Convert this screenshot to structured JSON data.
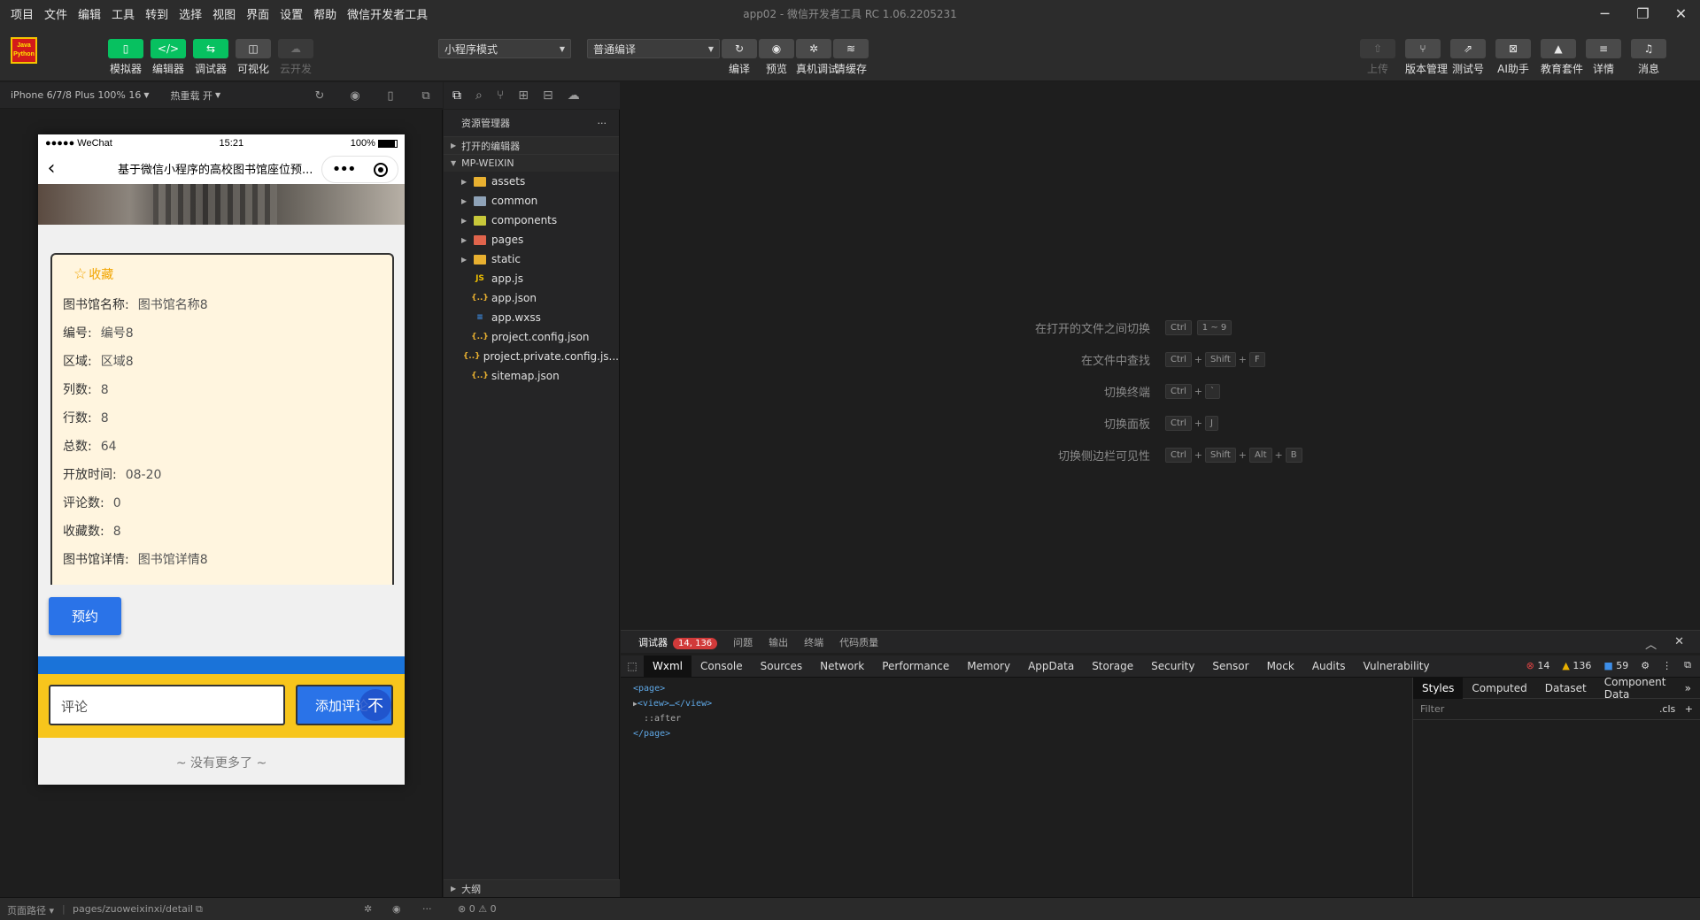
{
  "menu": [
    "项目",
    "文件",
    "编辑",
    "工具",
    "转到",
    "选择",
    "视图",
    "界面",
    "设置",
    "帮助",
    "微信开发者工具"
  ],
  "window_title": "app02 - 微信开发者工具 RC 1.06.2205231",
  "logo": {
    "line1": "Java",
    "line2": "Python"
  },
  "toolbar": {
    "left_buttons": [
      {
        "label": "模拟器",
        "icon": "phone-icon",
        "glyph": "▯"
      },
      {
        "label": "编辑器",
        "icon": "code-icon",
        "glyph": "</>"
      },
      {
        "label": "调试器",
        "icon": "debug-icon",
        "glyph": "⇆"
      },
      {
        "label": "可视化",
        "icon": "layout-icon",
        "glyph": "◫"
      },
      {
        "label": "云开发",
        "icon": "cloud-icon",
        "glyph": "☁"
      }
    ],
    "mode_select": "小程序模式",
    "compile_select": "普通编译",
    "mid_buttons": [
      {
        "label": "编译",
        "icon": "refresh-icon",
        "glyph": "↻"
      },
      {
        "label": "预览",
        "icon": "eye-icon",
        "glyph": "◉"
      },
      {
        "label": "真机调试",
        "icon": "bug-icon",
        "glyph": "✲"
      },
      {
        "label": "清缓存",
        "icon": "layers-icon",
        "glyph": "≋"
      }
    ],
    "right_buttons": [
      {
        "label": "上传",
        "icon": "upload-icon",
        "glyph": "⇧"
      },
      {
        "label": "版本管理",
        "icon": "branch-icon",
        "glyph": "⑂"
      },
      {
        "label": "测试号",
        "icon": "external-icon",
        "glyph": "⇗"
      },
      {
        "label": "AI助手",
        "icon": "ai-icon",
        "glyph": "⊠"
      },
      {
        "label": "教育套件",
        "icon": "graduation-icon",
        "glyph": "▲"
      },
      {
        "label": "详情",
        "icon": "menu-icon",
        "glyph": "≡"
      },
      {
        "label": "消息",
        "icon": "bell-icon",
        "glyph": "♫"
      }
    ]
  },
  "sim": {
    "device": "iPhone 6/7/8 Plus 100% 16",
    "hotreload": "热重载 开"
  },
  "phone": {
    "status_left": "●●●●● WeChat",
    "status_time": "15:21",
    "status_right": "100%",
    "nav_title": "基于微信小程序的高校图书馆座位预...",
    "favorite": "收藏",
    "fields": [
      {
        "k": "图书馆名称:",
        "v": "图书馆名称8"
      },
      {
        "k": "编号:",
        "v": "编号8"
      },
      {
        "k": "区域:",
        "v": "区域8"
      },
      {
        "k": "列数:",
        "v": "8"
      },
      {
        "k": "行数:",
        "v": "8"
      },
      {
        "k": "总数:",
        "v": "64"
      },
      {
        "k": "开放时间:",
        "v": "08-20"
      },
      {
        "k": "评论数:",
        "v": "0"
      },
      {
        "k": "收藏数:",
        "v": "8"
      },
      {
        "k": "图书馆详情:",
        "v": "图书馆详情8"
      }
    ],
    "reserve_button": "预约",
    "comment_placeholder": "评论",
    "add_comment_button": "添加评论",
    "top_fab": "不",
    "no_more": "~ 没有更多了 ~"
  },
  "explorer": {
    "header": "资源管理器",
    "open_editors": "打开的编辑器",
    "project": "MP-WEIXIN",
    "items": [
      {
        "name": "assets",
        "type": "folder",
        "color": "#e8b030",
        "glyph": ""
      },
      {
        "name": "common",
        "type": "folder",
        "color": "#8fa3b8",
        "glyph": ""
      },
      {
        "name": "components",
        "type": "folder",
        "color": "#c8c83a",
        "glyph": ""
      },
      {
        "name": "pages",
        "type": "folder",
        "color": "#e0644c",
        "glyph": ""
      },
      {
        "name": "static",
        "type": "folder",
        "color": "#e8b030",
        "glyph": ""
      },
      {
        "name": "app.js",
        "type": "file",
        "color": "#f0c000",
        "glyph": "JS"
      },
      {
        "name": "app.json",
        "type": "file",
        "color": "#e8b030",
        "glyph": "{..}"
      },
      {
        "name": "app.wxss",
        "type": "file",
        "color": "#3d8ee8",
        "glyph": "≡"
      },
      {
        "name": "project.config.json",
        "type": "file",
        "color": "#e8b030",
        "glyph": "{..}"
      },
      {
        "name": "project.private.config.js...",
        "type": "file",
        "color": "#e8b030",
        "glyph": "{..}"
      },
      {
        "name": "sitemap.json",
        "type": "file",
        "color": "#e8b030",
        "glyph": "{..}"
      }
    ],
    "outline": "大纲"
  },
  "shortcuts": [
    {
      "label": "在打开的文件之间切换",
      "keys": [
        "Ctrl",
        "1 ~ 9"
      ],
      "joiners": [
        ""
      ]
    },
    {
      "label": "在文件中查找",
      "keys": [
        "Ctrl",
        "Shift",
        "F"
      ],
      "joiners": [
        "+",
        "+"
      ]
    },
    {
      "label": "切换终端",
      "keys": [
        "Ctrl",
        "`"
      ],
      "joiners": [
        "+"
      ]
    },
    {
      "label": "切换面板",
      "keys": [
        "Ctrl",
        "J"
      ],
      "joiners": [
        "+"
      ]
    },
    {
      "label": "切换侧边栏可见性",
      "keys": [
        "Ctrl",
        "Shift",
        "Alt",
        "B"
      ],
      "joiners": [
        "+",
        "+",
        "+"
      ]
    }
  ],
  "debugger": {
    "tabs": [
      "调试器",
      "问题",
      "输出",
      "终端",
      "代码质量"
    ],
    "badge": "14, 136",
    "panel_tabs": [
      "Wxml",
      "Console",
      "Sources",
      "Network",
      "Performance",
      "Memory",
      "AppData",
      "Storage",
      "Security",
      "Sensor",
      "Mock",
      "Audits",
      "Vulnerability"
    ],
    "errors": "14",
    "warnings": "136",
    "infos": "59",
    "wxml_lines": [
      "<page>",
      "<view>…</view>",
      "::after",
      "</page>"
    ],
    "styles_tabs": [
      "Styles",
      "Computed",
      "Dataset",
      "Component Data"
    ],
    "filter_placeholder": "Filter",
    "cls": ".cls"
  },
  "statusbar": {
    "path_label": "页面路径",
    "path": "pages/zuoweixinxi/detail",
    "errors": "0",
    "warnings": "0"
  }
}
